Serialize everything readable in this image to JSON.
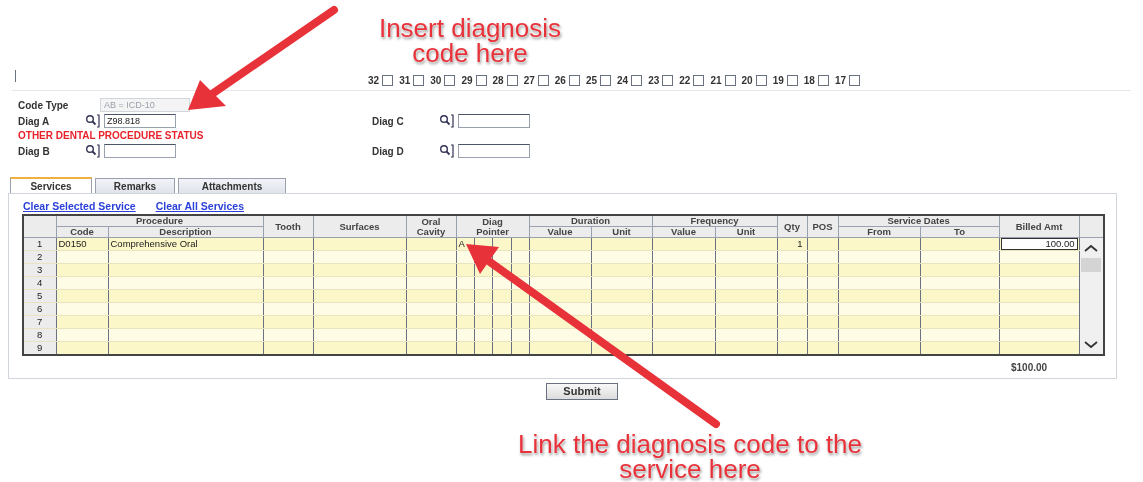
{
  "annotations": [
    {
      "lines": [
        "Insert diagnosis",
        "code here"
      ]
    },
    {
      "lines": [
        "Link the diagnosis code to the",
        "service here"
      ]
    }
  ],
  "teeth": [
    {
      "label": "32",
      "checked": false
    },
    {
      "label": "31",
      "checked": false
    },
    {
      "label": "30",
      "checked": false
    },
    {
      "label": "29",
      "checked": false
    },
    {
      "label": "28",
      "checked": false
    },
    {
      "label": "27",
      "checked": false
    },
    {
      "label": "26",
      "checked": false
    },
    {
      "label": "25",
      "checked": false
    },
    {
      "label": "24",
      "checked": false
    },
    {
      "label": "23",
      "checked": false
    },
    {
      "label": "22",
      "checked": false
    },
    {
      "label": "21",
      "checked": false
    },
    {
      "label": "20",
      "checked": false
    },
    {
      "label": "19",
      "checked": false
    },
    {
      "label": "18",
      "checked": false
    },
    {
      "label": "17",
      "checked": false
    }
  ],
  "code_type": {
    "label": "Code Type",
    "value": "AB = ICD-10",
    "disabled": true
  },
  "diag_rows": [
    [
      {
        "label": "Diag A",
        "value": "Z98.818",
        "description": "OTHER DENTAL PROCEDURE STATUS"
      },
      {
        "label": "Diag C"
      }
    ],
    [
      {
        "label": "Diag B"
      },
      {
        "label": "Diag D"
      }
    ]
  ],
  "tabs": [
    {
      "label": "Services",
      "selected": true
    },
    {
      "label": "Remarks",
      "selected": false
    },
    {
      "label": "Attachments",
      "selected": false
    }
  ],
  "links": [
    "Clear Selected Service",
    "Clear All Services"
  ],
  "table": {
    "header_groups": [
      {
        "label": "Procedure",
        "columns": [
          "Code",
          "Description"
        ]
      },
      {
        "label": "Tooth"
      },
      {
        "label": "Surfaces"
      },
      {
        "label": "Oral Cavity"
      },
      {
        "label": "Diag Pointer",
        "kind": "pointer"
      },
      {
        "label": "Duration",
        "columns": [
          "Value",
          "Unit"
        ]
      },
      {
        "label": "Frequency",
        "columns": [
          "Value",
          "Unit"
        ]
      },
      {
        "label": "Qty"
      },
      {
        "label": "POS"
      },
      {
        "label": "Service Dates",
        "columns": [
          "From",
          "To"
        ]
      },
      {
        "label": "Billed Amt"
      }
    ],
    "rows": [
      {
        "number": "1",
        "code": "D0150",
        "description": "Comprehensive Oral",
        "diag_pointer": "A",
        "qty": "1",
        "billed_amt": "100.00"
      },
      {
        "number": "2"
      },
      {
        "number": "3"
      },
      {
        "number": "4"
      },
      {
        "number": "5"
      },
      {
        "number": "6"
      },
      {
        "number": "7"
      },
      {
        "number": "8"
      },
      {
        "number": "9"
      }
    ],
    "total": "$100.00"
  },
  "submit": "Submit"
}
